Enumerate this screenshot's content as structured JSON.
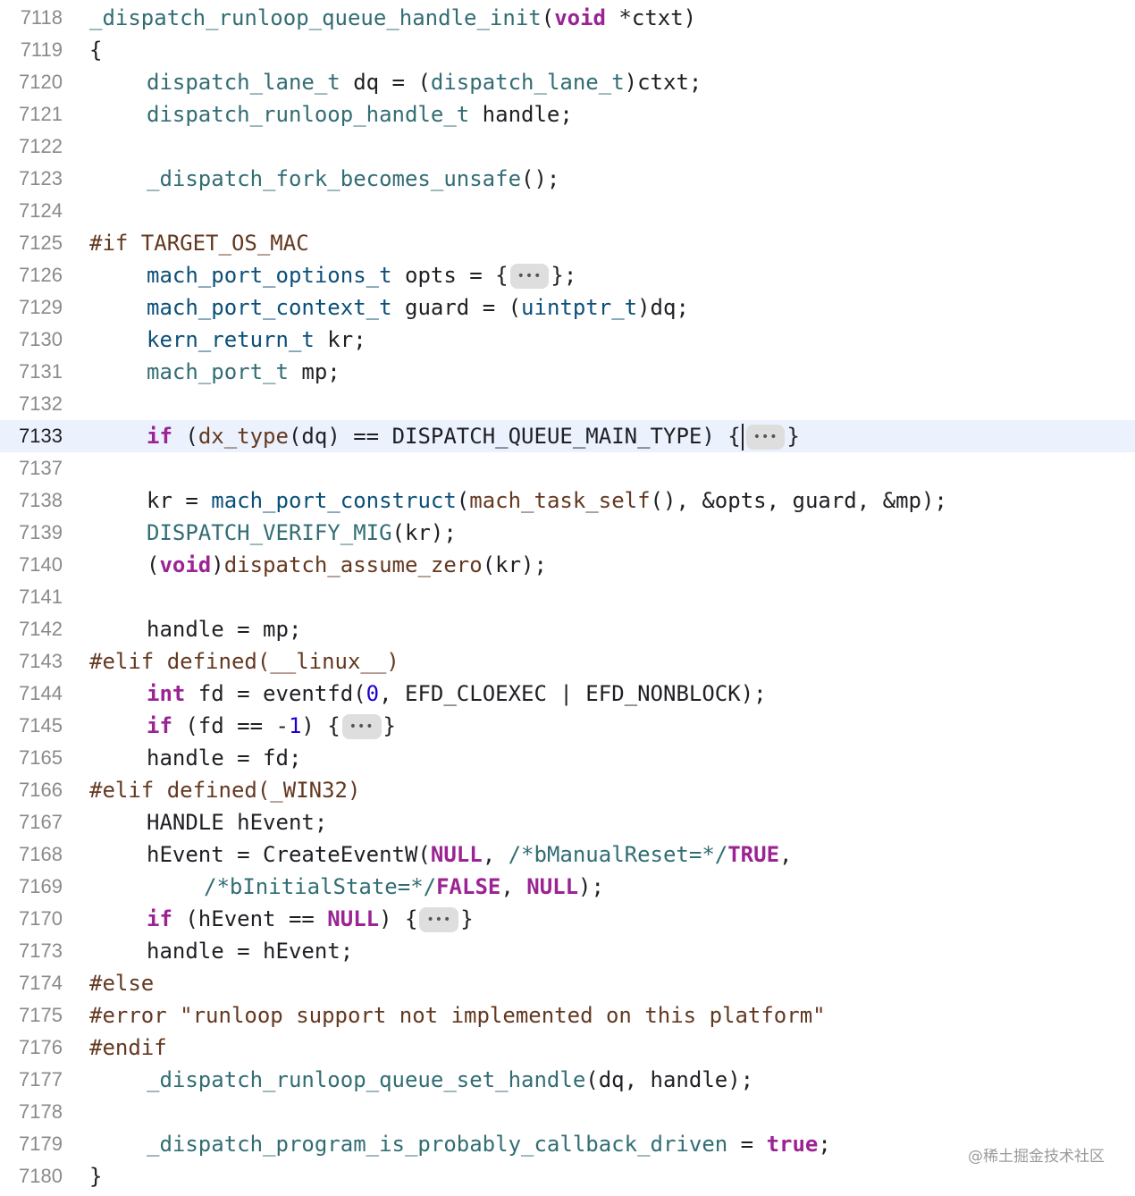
{
  "editor": {
    "current_line": "7133",
    "lines": [
      {
        "n": "7118",
        "indent": 0,
        "tokens": [
          [
            "fn",
            "_dispatch_runloop_queue_handle_init"
          ],
          [
            "plain",
            "("
          ],
          [
            "kw",
            "void"
          ],
          [
            "plain",
            " *ctxt)"
          ]
        ]
      },
      {
        "n": "7119",
        "indent": 0,
        "tokens": [
          [
            "plain",
            "{"
          ]
        ]
      },
      {
        "n": "7120",
        "indent": 4,
        "tokens": [
          [
            "fn",
            "dispatch_lane_t"
          ],
          [
            "plain",
            " dq = ("
          ],
          [
            "fn",
            "dispatch_lane_t"
          ],
          [
            "plain",
            ")ctxt;"
          ]
        ]
      },
      {
        "n": "7121",
        "indent": 4,
        "tokens": [
          [
            "fn",
            "dispatch_runloop_handle_t"
          ],
          [
            "plain",
            " handle;"
          ]
        ]
      },
      {
        "n": "7122",
        "indent": 0,
        "tokens": []
      },
      {
        "n": "7123",
        "indent": 4,
        "tokens": [
          [
            "fn",
            "_dispatch_fork_becomes_unsafe"
          ],
          [
            "plain",
            "();"
          ]
        ]
      },
      {
        "n": "7124",
        "indent": 0,
        "tokens": []
      },
      {
        "n": "7125",
        "indent": 0,
        "tokens": [
          [
            "pp",
            "#if TARGET_OS_MAC"
          ]
        ]
      },
      {
        "n": "7126",
        "indent": 4,
        "tokens": [
          [
            "type",
            "mach_port_options_t"
          ],
          [
            "plain",
            " opts = {"
          ],
          [
            "fold",
            "•••"
          ],
          [
            "plain",
            "};"
          ]
        ]
      },
      {
        "n": "7129",
        "indent": 4,
        "tokens": [
          [
            "type",
            "mach_port_context_t"
          ],
          [
            "plain",
            " guard = ("
          ],
          [
            "type",
            "uintptr_t"
          ],
          [
            "plain",
            ")dq;"
          ]
        ]
      },
      {
        "n": "7130",
        "indent": 4,
        "tokens": [
          [
            "type",
            "kern_return_t"
          ],
          [
            "plain",
            " kr;"
          ]
        ]
      },
      {
        "n": "7131",
        "indent": 4,
        "tokens": [
          [
            "fn",
            "mach_port_t"
          ],
          [
            "plain",
            " mp;"
          ]
        ]
      },
      {
        "n": "7132",
        "indent": 0,
        "tokens": []
      },
      {
        "n": "7133",
        "indent": 4,
        "tokens": [
          [
            "kw",
            "if"
          ],
          [
            "plain",
            " ("
          ],
          [
            "pp",
            "dx_type"
          ],
          [
            "plain",
            "(dq) == DISPATCH_QUEUE_MAIN_TYPE) {"
          ],
          [
            "cursor",
            ""
          ],
          [
            "fold",
            "•••"
          ],
          [
            "plain",
            "}"
          ]
        ]
      },
      {
        "n": "7137",
        "indent": 0,
        "tokens": []
      },
      {
        "n": "7138",
        "indent": 4,
        "tokens": [
          [
            "plain",
            "kr = "
          ],
          [
            "type",
            "mach_port_construct"
          ],
          [
            "plain",
            "("
          ],
          [
            "pp",
            "mach_task_self"
          ],
          [
            "plain",
            "(), &opts, guard, &mp);"
          ]
        ]
      },
      {
        "n": "7139",
        "indent": 4,
        "tokens": [
          [
            "fn",
            "DISPATCH_VERIFY_MIG"
          ],
          [
            "plain",
            "(kr);"
          ]
        ]
      },
      {
        "n": "7140",
        "indent": 4,
        "tokens": [
          [
            "plain",
            "("
          ],
          [
            "kw",
            "void"
          ],
          [
            "plain",
            ")"
          ],
          [
            "pp",
            "dispatch_assume_zero"
          ],
          [
            "plain",
            "(kr);"
          ]
        ]
      },
      {
        "n": "7141",
        "indent": 0,
        "tokens": []
      },
      {
        "n": "7142",
        "indent": 4,
        "tokens": [
          [
            "plain",
            "handle = mp;"
          ]
        ]
      },
      {
        "n": "7143",
        "indent": 0,
        "tokens": [
          [
            "pp",
            "#elif defined(__linux__)"
          ]
        ]
      },
      {
        "n": "7144",
        "indent": 4,
        "tokens": [
          [
            "kw",
            "int"
          ],
          [
            "plain",
            " fd = eventfd("
          ],
          [
            "num",
            "0"
          ],
          [
            "plain",
            ", EFD_CLOEXEC | EFD_NONBLOCK);"
          ]
        ]
      },
      {
        "n": "7145",
        "indent": 4,
        "tokens": [
          [
            "kw",
            "if"
          ],
          [
            "plain",
            " (fd == -"
          ],
          [
            "num",
            "1"
          ],
          [
            "plain",
            ") {"
          ],
          [
            "fold",
            "•••"
          ],
          [
            "plain",
            "}"
          ]
        ]
      },
      {
        "n": "7165",
        "indent": 4,
        "tokens": [
          [
            "plain",
            "handle = fd;"
          ]
        ]
      },
      {
        "n": "7166",
        "indent": 0,
        "tokens": [
          [
            "pp",
            "#elif defined(_WIN32)"
          ]
        ]
      },
      {
        "n": "7167",
        "indent": 4,
        "tokens": [
          [
            "plain",
            "HANDLE hEvent;"
          ]
        ]
      },
      {
        "n": "7168",
        "indent": 4,
        "tokens": [
          [
            "plain",
            "hEvent = CreateEventW("
          ],
          [
            "kw",
            "NULL"
          ],
          [
            "plain",
            ", "
          ],
          [
            "comment",
            "/*bManualReset=*/"
          ],
          [
            "kw",
            "TRUE"
          ],
          [
            "plain",
            ","
          ]
        ]
      },
      {
        "n": "7169",
        "indent": 8,
        "tokens": [
          [
            "comment",
            "/*bInitialState=*/"
          ],
          [
            "kw",
            "FALSE"
          ],
          [
            "plain",
            ", "
          ],
          [
            "kw",
            "NULL"
          ],
          [
            "plain",
            ");"
          ]
        ]
      },
      {
        "n": "7170",
        "indent": 4,
        "tokens": [
          [
            "kw",
            "if"
          ],
          [
            "plain",
            " (hEvent == "
          ],
          [
            "kw",
            "NULL"
          ],
          [
            "plain",
            ") {"
          ],
          [
            "fold",
            "•••"
          ],
          [
            "plain",
            "}"
          ]
        ]
      },
      {
        "n": "7173",
        "indent": 4,
        "tokens": [
          [
            "plain",
            "handle = hEvent;"
          ]
        ]
      },
      {
        "n": "7174",
        "indent": 0,
        "tokens": [
          [
            "pp",
            "#else"
          ]
        ]
      },
      {
        "n": "7175",
        "indent": 0,
        "tokens": [
          [
            "pp",
            "#error \"runloop support not implemented on this platform\""
          ]
        ]
      },
      {
        "n": "7176",
        "indent": 0,
        "tokens": [
          [
            "pp",
            "#endif"
          ]
        ]
      },
      {
        "n": "7177",
        "indent": 4,
        "tokens": [
          [
            "fn",
            "_dispatch_runloop_queue_set_handle"
          ],
          [
            "plain",
            "(dq, handle);"
          ]
        ]
      },
      {
        "n": "7178",
        "indent": 0,
        "tokens": []
      },
      {
        "n": "7179",
        "indent": 4,
        "tokens": [
          [
            "fn",
            "_dispatch_program_is_probably_callback_driven"
          ],
          [
            "plain",
            " = "
          ],
          [
            "kw",
            "true"
          ],
          [
            "plain",
            ";"
          ]
        ]
      },
      {
        "n": "7180",
        "indent": 0,
        "tokens": [
          [
            "plain",
            "}"
          ]
        ]
      }
    ]
  },
  "watermark": "@稀土掘金技术社区"
}
